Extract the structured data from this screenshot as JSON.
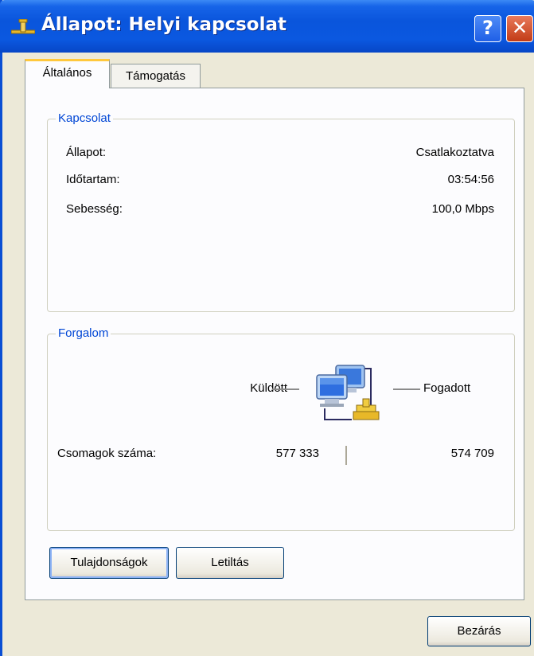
{
  "window": {
    "title": "Állapot: Helyi kapcsolat"
  },
  "titlebar": {
    "help_label": "?",
    "close_label": "✕"
  },
  "tabs": [
    {
      "label": "Általános",
      "active": true
    },
    {
      "label": "Támogatás",
      "active": false
    }
  ],
  "connection": {
    "legend": "Kapcsolat",
    "rows": [
      {
        "label": "Állapot:",
        "value": "Csatlakoztatva"
      },
      {
        "label": "Időtartam:",
        "value": "03:54:56"
      },
      {
        "label": "Sebesség:",
        "value": "100,0 Mbps"
      }
    ]
  },
  "traffic": {
    "legend": "Forgalom",
    "sent_label": "Küldött",
    "received_label": "Fogadott",
    "packets_label": "Csomagok száma:",
    "packets_sent": "577 333",
    "packets_received": "574 709",
    "icon": "network-computers-icon"
  },
  "buttons": {
    "properties": "Tulajdonságok",
    "disable": "Letiltás",
    "close": "Bezárás"
  },
  "colors": {
    "title_bar": "#0a55dc",
    "group_legend": "#0046d5",
    "active_tab_highlight": "#ffc83c",
    "close_button": "#c23b16"
  }
}
